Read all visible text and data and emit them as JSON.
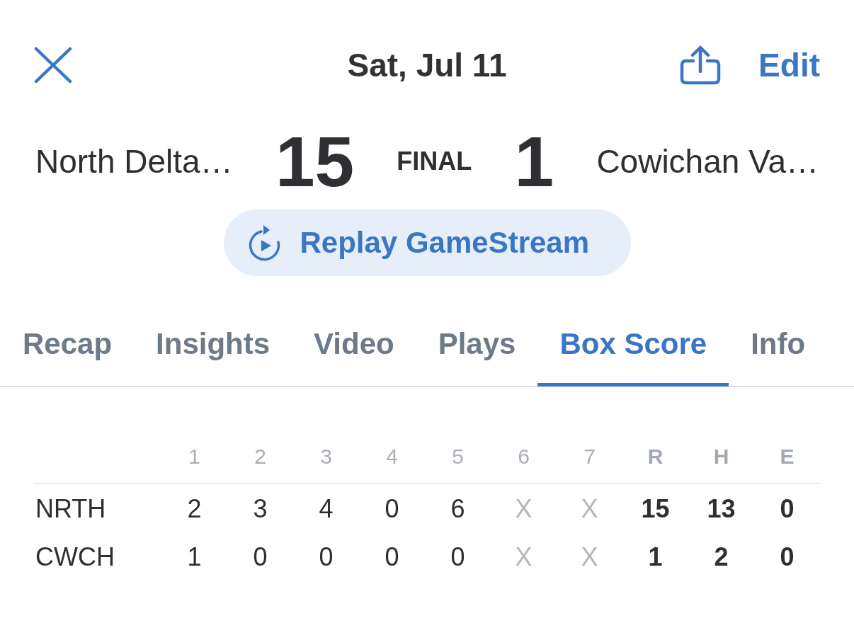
{
  "header": {
    "title": "Sat, Jul 11",
    "edit_label": "Edit"
  },
  "scoreboard": {
    "teams": [
      {
        "name": "North Delta…",
        "score": "15"
      },
      {
        "name": "Cowichan Va…",
        "score": "1"
      }
    ],
    "status": "FINAL"
  },
  "replay_button": {
    "label": "Replay GameStream"
  },
  "tabs": [
    {
      "label": "Recap",
      "selected": false
    },
    {
      "label": "Insights",
      "selected": false
    },
    {
      "label": "Video",
      "selected": false
    },
    {
      "label": "Plays",
      "selected": false
    },
    {
      "label": "Box Score",
      "selected": true
    },
    {
      "label": "Info",
      "selected": false
    }
  ],
  "box_score": {
    "columns": [
      {
        "label": "1",
        "kind": "inning"
      },
      {
        "label": "2",
        "kind": "inning"
      },
      {
        "label": "3",
        "kind": "inning"
      },
      {
        "label": "4",
        "kind": "inning"
      },
      {
        "label": "5",
        "kind": "inning"
      },
      {
        "label": "6",
        "kind": "unplayed"
      },
      {
        "label": "7",
        "kind": "unplayed"
      },
      {
        "label": "R",
        "kind": "total"
      },
      {
        "label": "H",
        "kind": "total"
      },
      {
        "label": "E",
        "kind": "total"
      }
    ],
    "rows": [
      {
        "team": "NRTH",
        "cells": [
          "2",
          "3",
          "4",
          "0",
          "6",
          "X",
          "X",
          "15",
          "13",
          "0"
        ]
      },
      {
        "team": "CWCH",
        "cells": [
          "1",
          "0",
          "0",
          "0",
          "0",
          "X",
          "X",
          "1",
          "2",
          "0"
        ]
      }
    ]
  }
}
